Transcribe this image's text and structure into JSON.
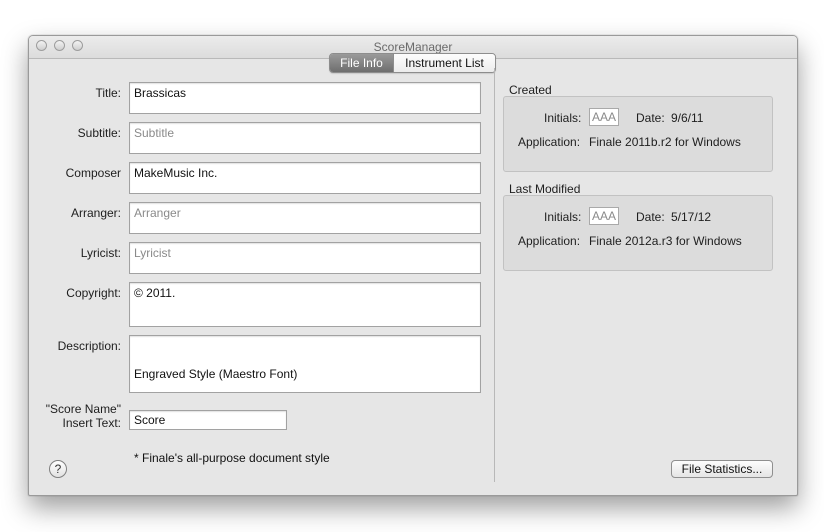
{
  "window": {
    "title": "ScoreManager"
  },
  "tabs": [
    {
      "label": "File Info",
      "selected": true
    },
    {
      "label": "Instrument List",
      "selected": false
    }
  ],
  "form": {
    "title": {
      "label": "Title:",
      "value": "Brassicas",
      "placeholder": ""
    },
    "subtitle": {
      "label": "Subtitle:",
      "value": "",
      "placeholder": "Subtitle"
    },
    "composer": {
      "label": "Composer",
      "value": "MakeMusic Inc.",
      "placeholder": ""
    },
    "arranger": {
      "label": "Arranger:",
      "value": "",
      "placeholder": "Arranger"
    },
    "lyricist": {
      "label": "Lyricist:",
      "value": "",
      "placeholder": "Lyricist"
    },
    "copyright": {
      "label": "Copyright:",
      "value": "© 2011.",
      "placeholder": ""
    },
    "description": {
      "label": "Description:",
      "line1": "Engraved Style (Maestro Font)",
      "line2": "* Finale's all-purpose document style"
    },
    "score_name": {
      "label_line1": "\"Score Name\"",
      "label_line2": "Insert Text:",
      "value": "Score"
    }
  },
  "created": {
    "heading": "Created",
    "initials_label": "Initials:",
    "initials_placeholder": "AAA",
    "date_label": "Date:",
    "date_value": "9/6/11",
    "application_label": "Application:",
    "application_value": "Finale 2011b.r2 for Windows"
  },
  "last_modified": {
    "heading": "Last Modified",
    "initials_label": "Initials:",
    "initials_placeholder": "AAA",
    "date_label": "Date:",
    "date_value": "5/17/12",
    "application_label": "Application:",
    "application_value": "Finale 2012a.r3 for Windows"
  },
  "buttons": {
    "help": "?",
    "file_statistics": "File Statistics..."
  },
  "colors": {
    "window_bg": "#e6e6e6",
    "group_bg": "#dcdcdc",
    "selected_tab": "#7a7a7a"
  }
}
